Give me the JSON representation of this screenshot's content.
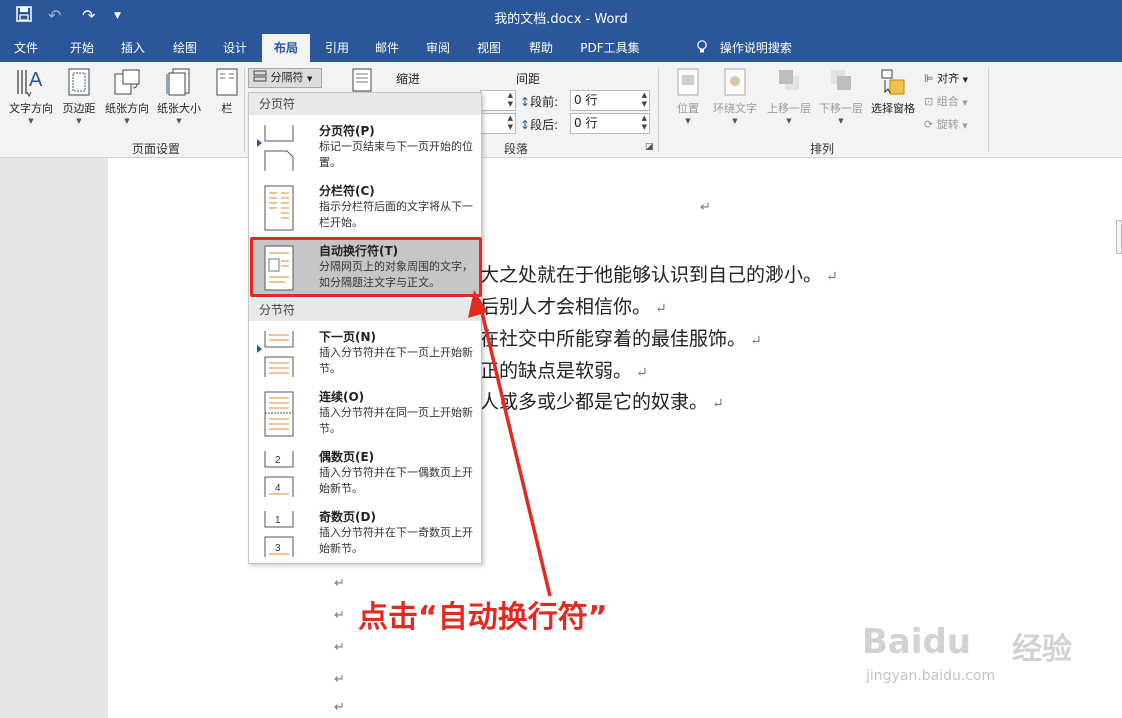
{
  "window": {
    "title": "我的文档.docx  -  Word"
  },
  "quick_access": {
    "save": "save-icon",
    "undo": "undo-icon",
    "redo": "redo-icon",
    "customize": "▼"
  },
  "tabs": [
    {
      "label": "文件"
    },
    {
      "label": "开始"
    },
    {
      "label": "插入"
    },
    {
      "label": "绘图"
    },
    {
      "label": "设计"
    },
    {
      "label": "布局",
      "active": true
    },
    {
      "label": "引用"
    },
    {
      "label": "邮件"
    },
    {
      "label": "审阅"
    },
    {
      "label": "视图"
    },
    {
      "label": "帮助"
    },
    {
      "label": "PDF工具集"
    }
  ],
  "tell_me": "操作说明搜索",
  "ribbon": {
    "page_setup": {
      "label": "页面设置",
      "buttons": [
        "文字方向",
        "页边距",
        "纸张方向",
        "纸张大小",
        "栏"
      ],
      "breaks_button": "分隔符"
    },
    "paragraph": {
      "label": "段落",
      "indent_label": "缩进",
      "spacing_label": "间距",
      "before_label": "段前:",
      "before_value": "0 行",
      "after_label": "段后:",
      "after_value": "0 行"
    },
    "arrange": {
      "label": "排列",
      "buttons": [
        "位置",
        "环绕文字",
        "上移一层",
        "下移一层",
        "选择窗格"
      ],
      "small": [
        "对齐",
        "组合",
        "旋转"
      ]
    }
  },
  "dropdown": {
    "page_breaks_header": "分页符",
    "section_breaks_header": "分节符",
    "items": [
      {
        "title": "分页符(P)",
        "desc": "标记一页结束与下一页开始的位置。"
      },
      {
        "title": "分栏符(C)",
        "desc": "指示分栏符后面的文字将从下一栏开始。"
      },
      {
        "title": "自动换行符(T)",
        "desc": "分隔网页上的对象周围的文字，如分隔题注文字与正文。"
      },
      {
        "title": "下一页(N)",
        "desc": "插入分节符并在下一页上开始新节。"
      },
      {
        "title": "连续(O)",
        "desc": "插入分节符并在同一页上开始新节。"
      },
      {
        "title": "偶数页(E)",
        "desc": "插入分节符并在下一偶数页上开始新节。"
      },
      {
        "title": "奇数页(D)",
        "desc": "插入分节符并在下一奇数页上开始新节。"
      }
    ]
  },
  "document": {
    "paragraph_mark": "↵",
    "lines": [
      "大之处就在于他能够认识到自己的渺小。",
      "后别人才会相信你。",
      "在社交中所能穿着的最佳服饰。",
      "正的缺点是软弱。",
      "人或多或少都是它的奴隶。"
    ]
  },
  "annotation": {
    "callout": "点击“自动换行符”",
    "color": "#e42a20"
  },
  "watermark": {
    "logo": "Baidu",
    "brand": "经验",
    "url": "jingyan.baidu.com"
  },
  "colors": {
    "accent": "#2b579a",
    "ribbon_bg": "#f3f3f3",
    "highlight": "#c6c6c6"
  }
}
